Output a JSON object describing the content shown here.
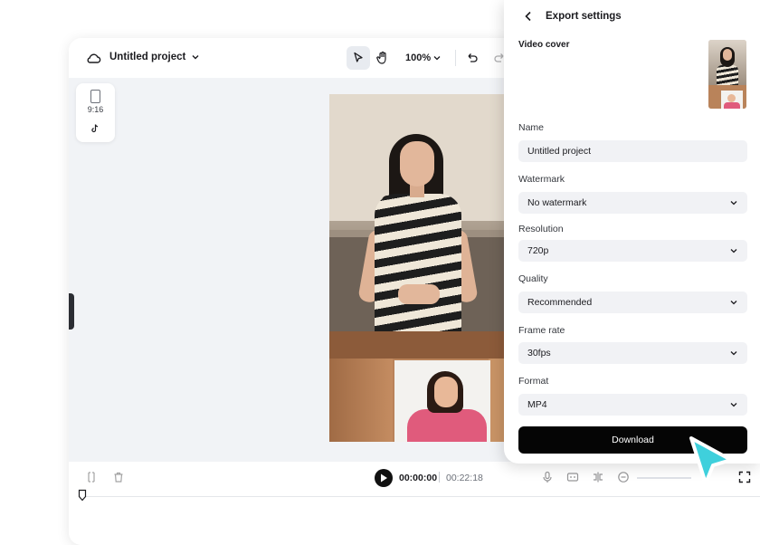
{
  "editor": {
    "project_title": "Untitled project",
    "zoom_level": "100%",
    "aspect_ratio": "9:16"
  },
  "player": {
    "current_time": "00:00:00",
    "total_time": "00:22:18"
  },
  "export_panel": {
    "title": "Export settings",
    "video_cover_label": "Video cover",
    "fields": {
      "name": {
        "label": "Name",
        "value": "Untitled project"
      },
      "watermark": {
        "label": "Watermark",
        "value": "No watermark"
      },
      "resolution": {
        "label": "Resolution",
        "value": "720p"
      },
      "quality": {
        "label": "Quality",
        "value": "Recommended"
      },
      "frame_rate": {
        "label": "Frame rate",
        "value": "30fps"
      },
      "format": {
        "label": "Format",
        "value": "MP4"
      }
    },
    "download_label": "Download"
  },
  "colors": {
    "accent_cursor": "#3fd0dc",
    "download_bg": "#050505",
    "canvas_bg": "#f1f3f6"
  }
}
